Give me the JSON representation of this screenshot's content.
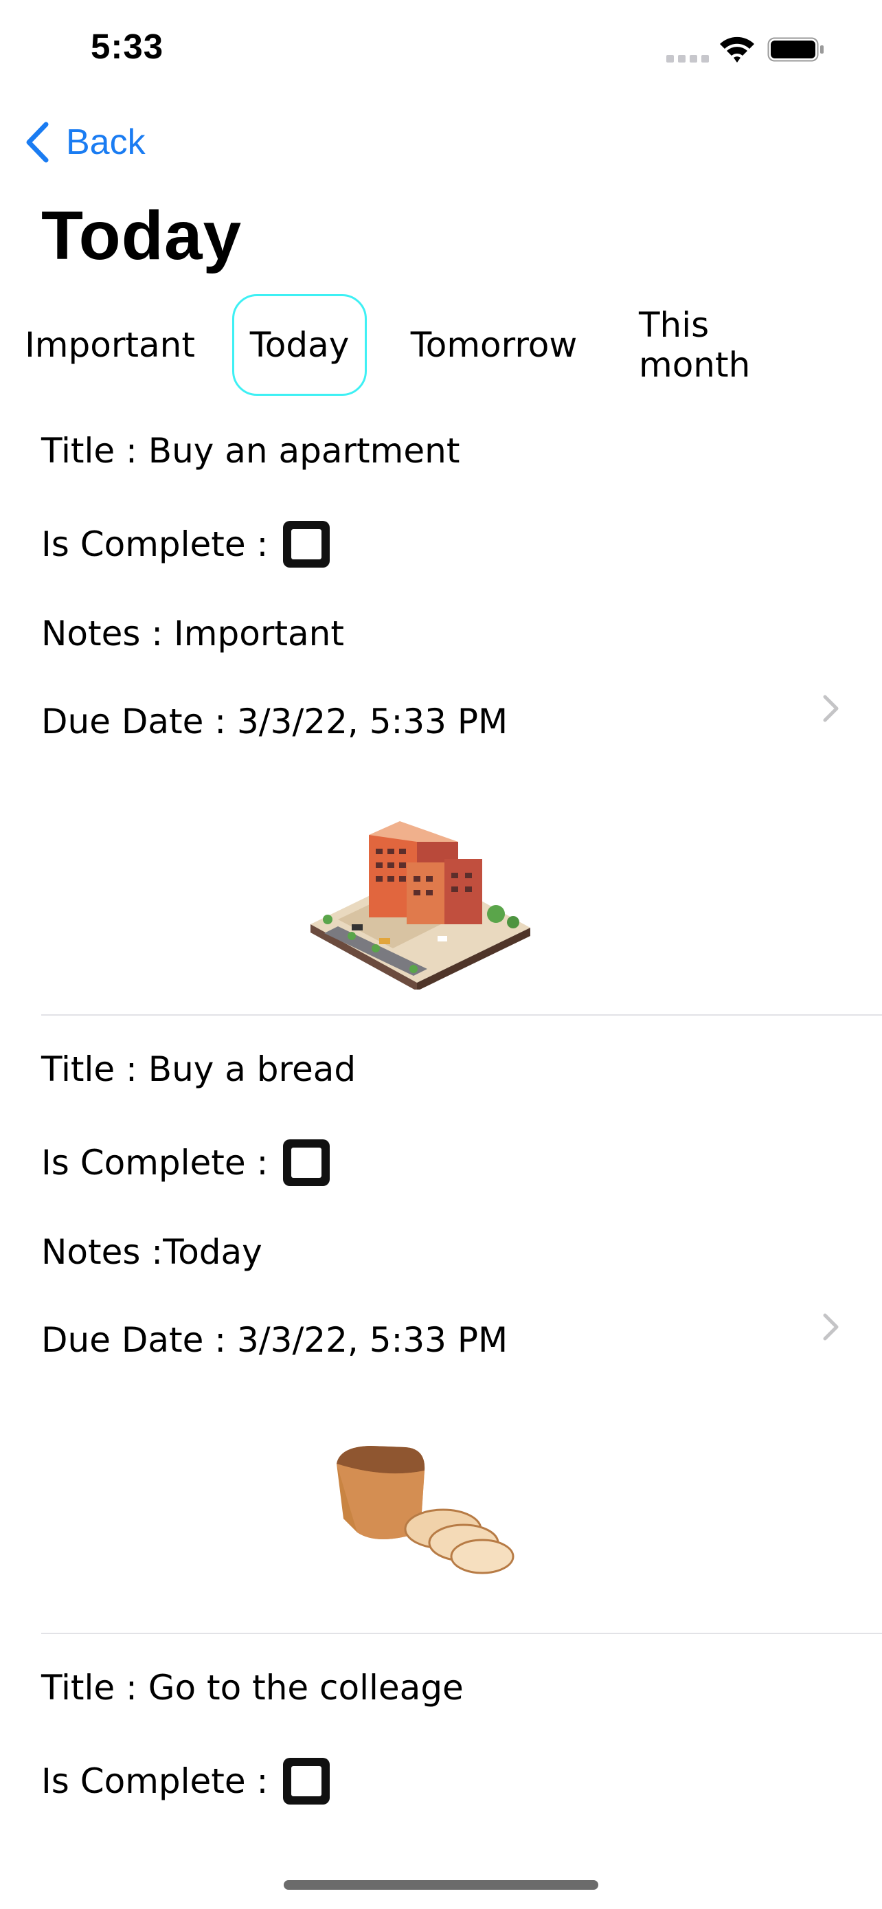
{
  "status_bar": {
    "time": "5:33"
  },
  "nav": {
    "back_label": "Back",
    "title": "Today"
  },
  "tabs": [
    {
      "label": "Important",
      "active": false
    },
    {
      "label": "Today",
      "active": true
    },
    {
      "label": "Tomorrow",
      "active": false
    },
    {
      "label": "This month",
      "active": false
    }
  ],
  "tasks": [
    {
      "title": "Title : Buy an apartment",
      "complete_label": "Is Complete :",
      "complete": false,
      "notes": "Notes : Important",
      "due": "Due Date : 3/3/22, 5:33 PM",
      "image": "apartment-building-illustration"
    },
    {
      "title": "Title : Buy a bread",
      "complete_label": "Is Complete :",
      "complete": false,
      "notes": "Notes :Today",
      "due": "Due Date : 3/3/22, 5:33 PM",
      "image": "bread-loaf-illustration"
    },
    {
      "title": "Title : Go to the colleage",
      "complete_label": "Is Complete :",
      "complete": false
    }
  ],
  "colors": {
    "accent": "#1a7cf2",
    "active_tab_border": "#3ef0f4",
    "separator": "#e2e2e6"
  }
}
